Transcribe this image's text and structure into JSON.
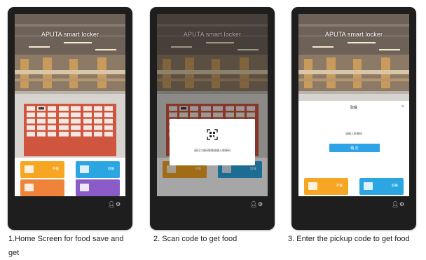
{
  "app_title": "APUTA smart locker",
  "screens": [
    {
      "caption": "1.Home Screen for food save and get",
      "tiles": [
        {
          "label": "存餐",
          "color": "#f6a623"
        },
        {
          "label": "取餐",
          "color": "#2ba6e2"
        },
        {
          "label": "",
          "color": "#f0833a"
        },
        {
          "label": "",
          "color": "#8b5cc7"
        }
      ]
    },
    {
      "caption": "2. Scan code to get food",
      "dialog_prompt": "请扫二维码取餐或输入取餐码"
    },
    {
      "caption": "3. Enter the pickup code to get food",
      "panel_title": "取餐",
      "panel_prompt": "请输入取餐码",
      "confirm_label": "确 定"
    }
  ],
  "colors": {
    "device_frame": "#1e1e1e",
    "locker": "#d0553f",
    "tile_orange": "#f6a623",
    "tile_blue": "#2ba6e2",
    "tile_deep_orange": "#f0833a",
    "tile_purple": "#8b5cc7",
    "button_blue": "#2ea3e6"
  },
  "icons": [
    "qr-scan-icon",
    "user-icon",
    "gear-icon",
    "close-icon"
  ]
}
